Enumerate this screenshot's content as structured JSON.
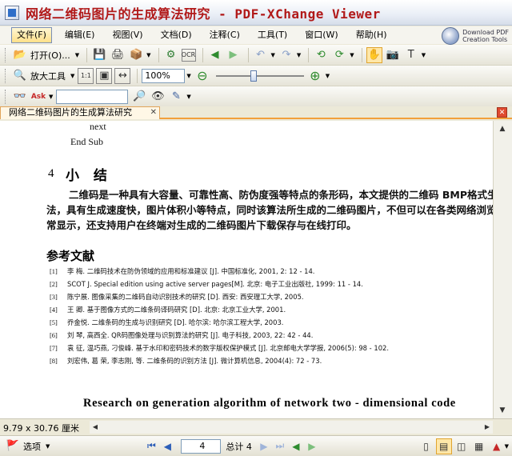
{
  "window": {
    "title": "网络二维码图片的生成算法研究 - PDF-XChange Viewer"
  },
  "menu": {
    "items": [
      "文件(F)",
      "编辑(E)",
      "视图(V)",
      "文档(D)",
      "注释(C)",
      "工具(T)",
      "窗口(W)",
      "帮助(H)"
    ],
    "promo": [
      "Download PDF",
      "Creation Tools"
    ]
  },
  "toolbar1": {
    "open_label": "打开(O)..."
  },
  "toolbar2": {
    "zoom_tool_label": "放大工具",
    "zoom_value": "100%",
    "zoom_slider_fraction": 0.42
  },
  "tabs": {
    "document": "网络二维码图片的生成算法研究"
  },
  "document": {
    "code": [
      "next",
      "End Sub"
    ],
    "section_number": "4",
    "section_title": "小 结",
    "paragraph": [
      "二维码是一种具有大容量、可靠性高、防伪度强等特点的条形码，本文提供的二维码 BMP格式生成",
      "法，具有生成速度快，图片体积小等特点，同时该算法所生成的二维码图片，不但可以在各类网络浏览器",
      "常显示，还支持用户在终端对生成的二维码图片下载保存与在线打印。"
    ],
    "refs_heading": "参考文献",
    "references": [
      {
        "n": "[1]",
        "text": "李 梅. 二维码技术在防伪领域的应用和标准建议 [J]. 中国标准化, 2001, 2: 12 - 14."
      },
      {
        "n": "[2]",
        "text": "SCOT J. Special edition using active server pages[M]. 北京: 电子工业出版社, 1999: 11 - 14."
      },
      {
        "n": "[3]",
        "text": "陈宁展. 图像采集的二维码自动识别技术的研究 [D]. 西安: 西安理工大学, 2005."
      },
      {
        "n": "[4]",
        "text": "王 卿. 基于图像方式的二维条码译码研究 [D]. 北京: 北京工业大学, 2001."
      },
      {
        "n": "[5]",
        "text": "乔金悦. 二维条码的生成与识别研究 [D]. 哈尔滨: 哈尔滨工程大学, 2003."
      },
      {
        "n": "[6]",
        "text": "刘 琴, 高西全. QR码图像处理与识别算法的研究 [J]. 电子科技, 2003, 22: 42 - 44."
      },
      {
        "n": "[7]",
        "text": "袁 征, 温巧燕, 刁俊峰. 基于水印和密码技术的数字版权保护模式 [J]. 北京邮电大学学报, 2006(5): 98 - 102."
      },
      {
        "n": "[8]",
        "text": "刘宏伟, 葛 荣, 李志刚, 等. 二维条码的识别方法 [J]. 微计算机信息, 2004(4): 72 - 73."
      }
    ],
    "english_title": "Research on generation algorithm of network two - dimensional code"
  },
  "status": {
    "size": "9.79 x 30.76 厘米"
  },
  "bottom": {
    "options_label": "选项",
    "current_page": "4",
    "total_label": "总计 4"
  }
}
